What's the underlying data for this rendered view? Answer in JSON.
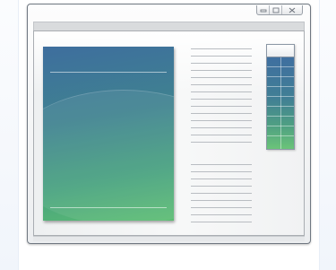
{
  "window": {
    "caption_buttons": [
      {
        "name": "minimize",
        "icon": "minimize-icon"
      },
      {
        "name": "maximize",
        "icon": "maximize-icon"
      },
      {
        "name": "close",
        "icon": "close-icon"
      }
    ]
  },
  "illustration": {
    "document_image_colors": [
      "#3e6e9e",
      "#46a07f",
      "#5cbd73"
    ],
    "table_colors": [
      "#3f6fa0",
      "#6bc479"
    ],
    "text_line_color": "#b9bdc2"
  }
}
